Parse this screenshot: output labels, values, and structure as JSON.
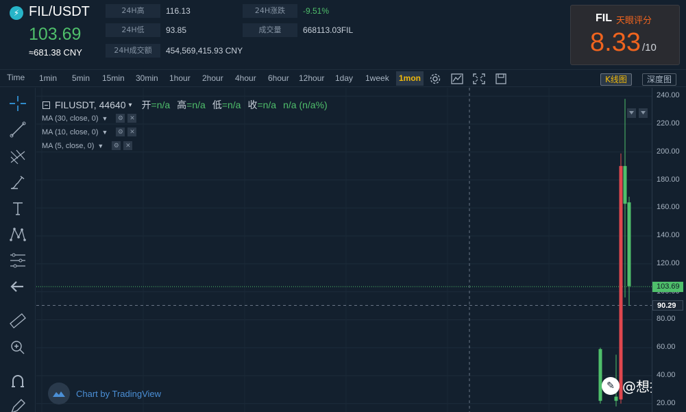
{
  "header": {
    "pair": "FIL/USDT",
    "logo_icon": "fil-coin-icon",
    "last_price": "103.69",
    "cny_price": "≈681.38 CNY",
    "stats": [
      {
        "label": "24H高",
        "value": "116.13"
      },
      {
        "label": "24H低",
        "value": "93.85"
      },
      {
        "label": "24H成交额",
        "value": "454,569,415.93 CNY"
      },
      {
        "label": "24H涨跌",
        "value": "-9.51%"
      },
      {
        "label": "成交量",
        "value": "668113.03FIL"
      }
    ],
    "score": {
      "coin": "FIL",
      "label": "天眼评分",
      "value": "8.33",
      "max": "/10"
    }
  },
  "toolbar": {
    "time_label": "Time",
    "timeframes": [
      "1min",
      "5min",
      "15min",
      "30min",
      "1hour",
      "2hour",
      "4hour",
      "6hour",
      "12hour",
      "1day",
      "1week",
      "1mon"
    ],
    "active_timeframe": "1mon",
    "kline_label": "K线图",
    "depth_label": "深度图",
    "icons": [
      "settings-icon",
      "indicator-icon",
      "fullscreen-icon",
      "save-icon"
    ]
  },
  "side_tools": [
    "crosshair-icon",
    "trendline-icon",
    "pitchfork-icon",
    "brush-icon",
    "text-icon",
    "pattern-icon",
    "fib-icon",
    "back-arrow-icon",
    "ruler-icon",
    "zoom-in-icon",
    "magnet-icon",
    "pencil-icon"
  ],
  "legend": {
    "symbol": "FILUSDT, 44640",
    "ohlc": [
      {
        "key": "开",
        "value": "=n/a"
      },
      {
        "key": "高",
        "value": "=n/a"
      },
      {
        "key": "低",
        "value": "=n/a"
      },
      {
        "key": "收",
        "value": "=n/a"
      }
    ],
    "change": "n/a (n/a%)",
    "ma": [
      "MA (30, close, 0)",
      "MA (10, close, 0)",
      "MA (5, close, 0)"
    ]
  },
  "watermark": "Chart by TradingView",
  "author": "@想挣钱",
  "price_axis": {
    "labels": [
      "240.00",
      "220.00",
      "200.00",
      "180.00",
      "160.00",
      "140.00",
      "120.00",
      "100.00",
      "80.00",
      "60.00",
      "40.00",
      "20.00"
    ],
    "last_price_tag": "103.69",
    "crosshair_tag": "90.29"
  },
  "chart_data": {
    "type": "candlestick",
    "ylim": [
      14,
      246
    ],
    "last_price": 103.69,
    "crosshair_price": 90.29,
    "candles": [
      {
        "open": 22,
        "high": 60,
        "low": 20,
        "close": 59,
        "color": "#4fbf6b"
      },
      {
        "open": 22,
        "high": 55,
        "low": 18,
        "close": 25,
        "color": "#4fbf6b"
      },
      {
        "open": 190,
        "high": 199,
        "low": 20,
        "close": 23,
        "color": "#e0474e"
      },
      {
        "open": 163,
        "high": 238,
        "low": 96,
        "close": 190,
        "color": "#4fbf6b"
      },
      {
        "open": 104,
        "high": 168,
        "low": 90,
        "close": 164,
        "color": "#4fbf6b"
      }
    ]
  }
}
